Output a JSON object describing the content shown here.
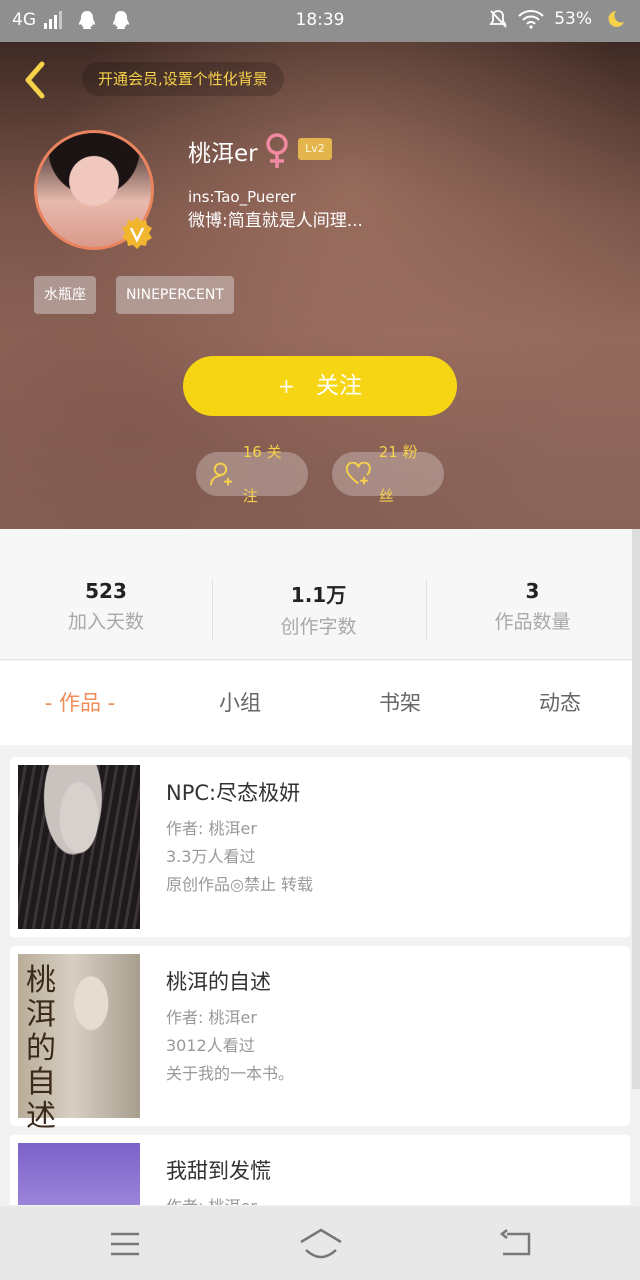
{
  "status_bar": {
    "network": "4G",
    "time": "18:39",
    "battery": "53%"
  },
  "header": {
    "vip_tip": "开通会员,设置个性化背景",
    "username": "桃洱er",
    "level": "Lv2",
    "ins": "ins:Tao_Puerer",
    "weibo": "微博:简直就是人间理...",
    "tags": [
      "水瓶座",
      "NINEPERCENT"
    ],
    "follow_button": {
      "plus": "+",
      "label": "关注"
    },
    "following_pill": "16 关注",
    "fans_pill": "21 粉丝",
    "colors": {
      "accent_yellow": "#f6d515",
      "gold_text": "#f5d24a",
      "avatar_border": "#e9845e"
    }
  },
  "stats": [
    {
      "value": "523",
      "label": "加入天数"
    },
    {
      "value": "1.1万",
      "label": "创作字数"
    },
    {
      "value": "3",
      "label": "作品数量"
    }
  ],
  "tabs": [
    "- 作品 -",
    "小组",
    "书架",
    "动态"
  ],
  "works": [
    {
      "title": "NPC:尽态极妍",
      "author": "作者: 桃洱er",
      "views": "3.3万人看过",
      "desc": "原创作品◎禁止 转载"
    },
    {
      "title": "桃洱的自述",
      "author": "作者: 桃洱er",
      "views": "3012人看过",
      "desc": "关于我的一本书。",
      "cover_text": "桃洱的自述"
    },
    {
      "title": "我甜到发慌",
      "author": "作者: 桃洱er",
      "views": "",
      "desc": ""
    }
  ],
  "icons": {
    "back": "chevron-left-icon",
    "gender": "female-icon",
    "badge": "verified-v-icon",
    "following": "person-add-icon",
    "fans": "heart-add-icon",
    "nav": [
      "menu-icon",
      "home-icon",
      "return-icon"
    ]
  }
}
